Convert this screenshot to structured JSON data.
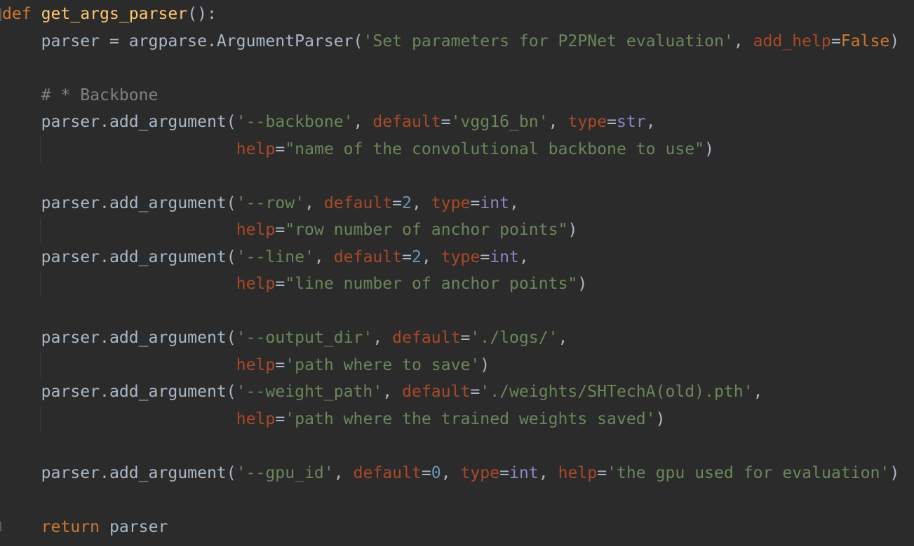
{
  "lines": [
    [
      [
        "kw",
        "def "
      ],
      [
        "fn",
        "get_args_parser"
      ],
      [
        "plain",
        "():"
      ]
    ],
    [
      [
        "plain",
        "    parser = argparse.ArgumentParser("
      ],
      [
        "str",
        "'Set parameters for P2PNet evaluation'"
      ],
      [
        "plain",
        ", "
      ],
      [
        "param",
        "add_help"
      ],
      [
        "plain",
        "="
      ],
      [
        "kw",
        "False"
      ],
      [
        "plain",
        ")"
      ]
    ],
    [],
    [
      [
        "comment",
        "    # * Backbone"
      ]
    ],
    [
      [
        "plain",
        "    parser.add_argument("
      ],
      [
        "str",
        "'--backbone'"
      ],
      [
        "plain",
        ", "
      ],
      [
        "param",
        "default"
      ],
      [
        "plain",
        "="
      ],
      [
        "str",
        "'vgg16_bn'"
      ],
      [
        "plain",
        ", "
      ],
      [
        "param",
        "type"
      ],
      [
        "plain",
        "="
      ],
      [
        "builtin",
        "str"
      ],
      [
        "plain",
        ","
      ]
    ],
    [
      [
        "plain",
        "                        "
      ],
      [
        "param",
        "help"
      ],
      [
        "plain",
        "="
      ],
      [
        "str",
        "\"name of the convolutional backbone to use\""
      ],
      [
        "plain",
        ")"
      ]
    ],
    [],
    [
      [
        "plain",
        "    parser.add_argument("
      ],
      [
        "str",
        "'--row'"
      ],
      [
        "plain",
        ", "
      ],
      [
        "param",
        "default"
      ],
      [
        "plain",
        "="
      ],
      [
        "num",
        "2"
      ],
      [
        "plain",
        ", "
      ],
      [
        "param",
        "type"
      ],
      [
        "plain",
        "="
      ],
      [
        "builtin",
        "int"
      ],
      [
        "plain",
        ","
      ]
    ],
    [
      [
        "plain",
        "                        "
      ],
      [
        "param",
        "help"
      ],
      [
        "plain",
        "="
      ],
      [
        "str",
        "\"row number of anchor points\""
      ],
      [
        "plain",
        ")"
      ]
    ],
    [
      [
        "plain",
        "    parser.add_argument("
      ],
      [
        "str",
        "'--line'"
      ],
      [
        "plain",
        ", "
      ],
      [
        "param",
        "default"
      ],
      [
        "plain",
        "="
      ],
      [
        "num",
        "2"
      ],
      [
        "plain",
        ", "
      ],
      [
        "param",
        "type"
      ],
      [
        "plain",
        "="
      ],
      [
        "builtin",
        "int"
      ],
      [
        "plain",
        ","
      ]
    ],
    [
      [
        "plain",
        "                        "
      ],
      [
        "param",
        "help"
      ],
      [
        "plain",
        "="
      ],
      [
        "str",
        "\"line number of anchor points\""
      ],
      [
        "plain",
        ")"
      ]
    ],
    [],
    [
      [
        "plain",
        "    parser.add_argument("
      ],
      [
        "str",
        "'--output_dir'"
      ],
      [
        "plain",
        ", "
      ],
      [
        "param",
        "default"
      ],
      [
        "plain",
        "="
      ],
      [
        "str",
        "'./logs/'"
      ],
      [
        "plain",
        ","
      ]
    ],
    [
      [
        "plain",
        "                        "
      ],
      [
        "param",
        "help"
      ],
      [
        "plain",
        "="
      ],
      [
        "str",
        "'path where to save'"
      ],
      [
        "plain",
        ")"
      ]
    ],
    [
      [
        "plain",
        "    parser.add_argument("
      ],
      [
        "str",
        "'--weight_path'"
      ],
      [
        "plain",
        ", "
      ],
      [
        "param",
        "default"
      ],
      [
        "plain",
        "="
      ],
      [
        "str",
        "'./weights/SHTechA(old).pth'"
      ],
      [
        "plain",
        ","
      ]
    ],
    [
      [
        "plain",
        "                        "
      ],
      [
        "param",
        "help"
      ],
      [
        "plain",
        "="
      ],
      [
        "str",
        "'path where the trained weights saved'"
      ],
      [
        "plain",
        ")"
      ]
    ],
    [],
    [
      [
        "plain",
        "    parser.add_argument("
      ],
      [
        "str",
        "'--gpu_id'"
      ],
      [
        "plain",
        ", "
      ],
      [
        "param",
        "default"
      ],
      [
        "plain",
        "="
      ],
      [
        "num",
        "0"
      ],
      [
        "plain",
        ", "
      ],
      [
        "param",
        "type"
      ],
      [
        "plain",
        "="
      ],
      [
        "builtin",
        "int"
      ],
      [
        "plain",
        ", "
      ],
      [
        "param",
        "help"
      ],
      [
        "plain",
        "="
      ],
      [
        "str",
        "'the gpu used for evaluation'"
      ],
      [
        "plain",
        ")"
      ]
    ],
    [],
    [
      [
        "plain",
        "    "
      ],
      [
        "kw",
        "return"
      ],
      [
        "plain",
        " parser"
      ]
    ]
  ],
  "colors": {
    "background": "#2b2b2b",
    "keyword": "#cc7832",
    "function": "#ffc66d",
    "string": "#6a8759",
    "parameter": "#aa4926",
    "number": "#6897bb",
    "builtin": "#8888c6",
    "comment": "#808080",
    "plain": "#a9b7c6"
  }
}
